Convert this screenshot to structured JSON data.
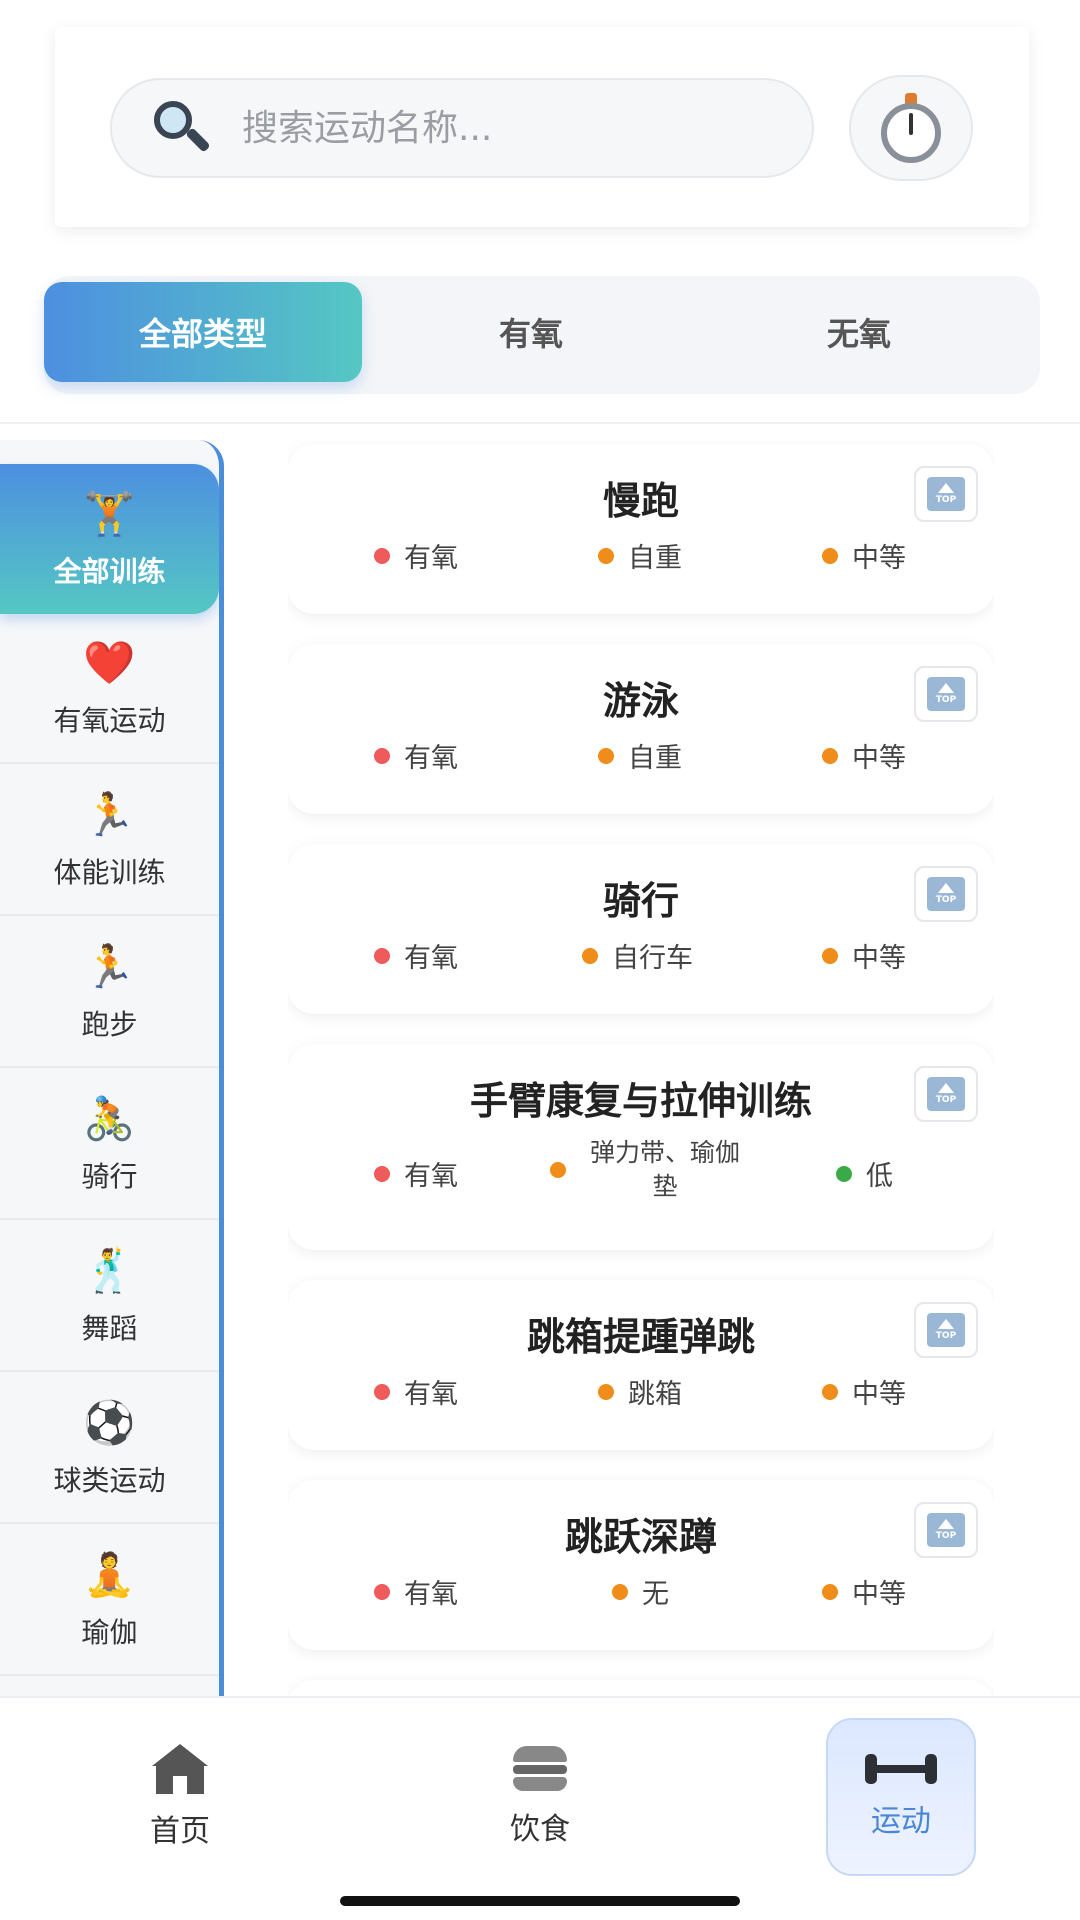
{
  "search": {
    "placeholder": "搜索运动名称...",
    "search_icon": "magnifier-icon",
    "timer_icon": "stopwatch-icon"
  },
  "type_tabs": [
    {
      "label": "全部类型",
      "active": true
    },
    {
      "label": "有氧",
      "active": false
    },
    {
      "label": "无氧",
      "active": false
    }
  ],
  "sidebar": {
    "items": [
      {
        "icon": "🏋️",
        "icon_name": "weightlifter-icon",
        "label": "全部训练",
        "active": true
      },
      {
        "icon": "❤️",
        "icon_name": "heart-icon",
        "label": "有氧运动"
      },
      {
        "icon": "🏃",
        "icon_name": "runner-icon",
        "label": "体能训练"
      },
      {
        "icon": "🏃",
        "icon_name": "runner-icon",
        "label": "跑步"
      },
      {
        "icon": "🚴",
        "icon_name": "cyclist-icon",
        "label": "骑行"
      },
      {
        "icon": "🕺",
        "icon_name": "dancer-icon",
        "label": "舞蹈"
      },
      {
        "icon": "⚽",
        "icon_name": "soccer-ball-icon",
        "label": "球类运动"
      },
      {
        "icon": "🧘",
        "icon_name": "yoga-icon",
        "label": "瑜伽"
      }
    ]
  },
  "exercises": [
    {
      "name": "慢跑",
      "type": "有氧",
      "equipment": "自重",
      "intensity": "中等",
      "intensity_color": "orange"
    },
    {
      "name": "游泳",
      "type": "有氧",
      "equipment": "自重",
      "intensity": "中等",
      "intensity_color": "orange"
    },
    {
      "name": "骑行",
      "type": "有氧",
      "equipment": "自行车",
      "intensity": "中等",
      "intensity_color": "orange"
    },
    {
      "name": "手臂康复与拉伸训练",
      "type": "有氧",
      "equipment": "弹力带、瑜伽垫",
      "intensity": "低",
      "intensity_color": "green"
    },
    {
      "name": "跳箱提踵弹跳",
      "type": "有氧",
      "equipment": "跳箱",
      "intensity": "中等",
      "intensity_color": "orange"
    },
    {
      "name": "跳跃深蹲",
      "type": "有氧",
      "equipment": "无",
      "intensity": "中等",
      "intensity_color": "orange"
    }
  ],
  "top_badge_text": "TOP",
  "bottom_nav": [
    {
      "label": "首页",
      "icon_name": "home-icon"
    },
    {
      "label": "饮食",
      "icon_name": "burger-icon"
    },
    {
      "label": "运动",
      "icon_name": "dumbbell-icon",
      "active": true
    }
  ],
  "colors": {
    "accent_start": "#4d8fe0",
    "accent_end": "#55c7c3",
    "type_dot": "#ef5a5a",
    "equipment_dot": "#f08c1a",
    "intensity_medium": "#f08c1a",
    "intensity_low": "#3aaa48"
  }
}
